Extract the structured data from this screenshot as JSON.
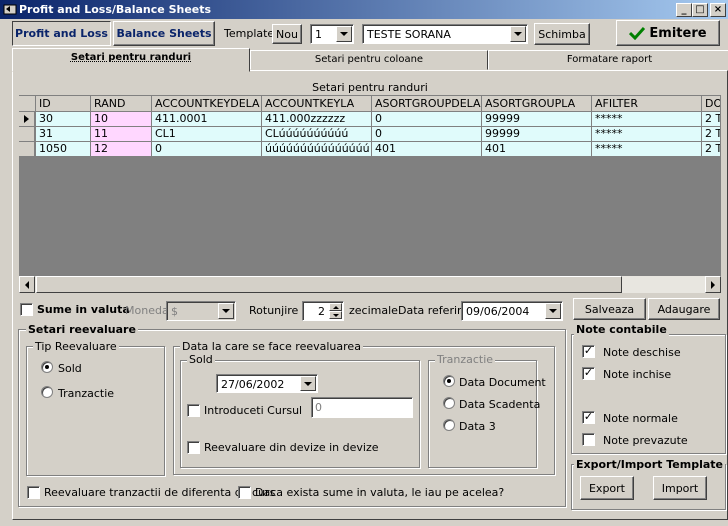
{
  "window": {
    "title": "Profit and Loss/Balance Sheets",
    "minimize": "_",
    "maximize": "□",
    "close": "×"
  },
  "toolbar": {
    "tab_profit_loss": "Profit and Loss",
    "tab_balance_sheets": "Balance Sheets",
    "template_label": "Template:",
    "nou_button": "Nou",
    "template_number": "1",
    "template_name": "TESTE SORANA",
    "schimba_button": "Schimba",
    "emitere_button": "Emitere"
  },
  "tabs": [
    {
      "label": "Setari pentru randuri",
      "active": true
    },
    {
      "label": "Setari pentru coloane",
      "active": false
    },
    {
      "label": "Formatare raport",
      "active": false
    }
  ],
  "grid": {
    "caption": "Setari pentru randuri",
    "columns": [
      "ID",
      "RAND",
      "ACCOUNTKEYDELA",
      "ACCOUNTKEYLA",
      "ASORTGROUPDELA",
      "ASORTGROUPLA",
      "AFILTER",
      "DO"
    ],
    "rows": [
      [
        "30",
        "10",
        "411.0001",
        "411.000zzzzzz",
        "0",
        "99999",
        "*****",
        "2 T"
      ],
      [
        "31",
        "11",
        "CL1",
        "CLúúúúúúúúúú",
        "0",
        "99999",
        "*****",
        "2 T"
      ],
      [
        "1050",
        "12",
        "0",
        "úúúúúúúúúúúúúúú",
        "401",
        "401",
        "*****",
        "2 T"
      ]
    ]
  },
  "options": {
    "sume_in_valuta": "Sume in valuta",
    "moneda_label": "Moneda",
    "moneda_value": "$",
    "rotunjire_label": "Rotunjire la",
    "rotunjire_value": "2",
    "zecimale_label": "zecimale",
    "data_referinta_label": "Data referinta",
    "data_referinta_value": "09/06/2004",
    "salveaza_button": "Salveaza",
    "adaugare_button": "Adaugare"
  },
  "reevaluare": {
    "title": "Setari reevaluare",
    "tip_title": "Tip Reevaluare",
    "radio_sold": "Sold",
    "radio_tranzactie": "Tranzactie",
    "data_title": "Data la care se face  reevaluarea",
    "sold_title": "Sold",
    "sold_date": "27/06/2002",
    "introduceti_cursul": "Introduceti Cursul",
    "curs_value": "0",
    "reevaluare_devize": "Reevaluare din devize in devize",
    "tranzactie_title": "Tranzactie",
    "radio_data_document": "Data Document",
    "radio_data_scadenta": "Data Scadenta",
    "radio_data3": "Data 3",
    "chk_diferenta": "Reevaluare tranzactii de diferenta de curs",
    "chk_exista_sume": "Daca exista sume in valuta, le iau pe acelea?"
  },
  "note": {
    "title": "Note contabile",
    "deschise": "Note deschise",
    "inchise": "Note inchise",
    "normale": "Note normale",
    "prevazute": "Note prevazute"
  },
  "export_import": {
    "title": "Export/Import Template",
    "export_button": "Export",
    "import_button": "Import"
  },
  "colors": {
    "title_start": "#0a246a",
    "title_end": "#a6caf0",
    "grid_row_bg": "#e0fbfb",
    "rand_col_bg": "#ffd7ff",
    "emitere_check": "#008000"
  }
}
